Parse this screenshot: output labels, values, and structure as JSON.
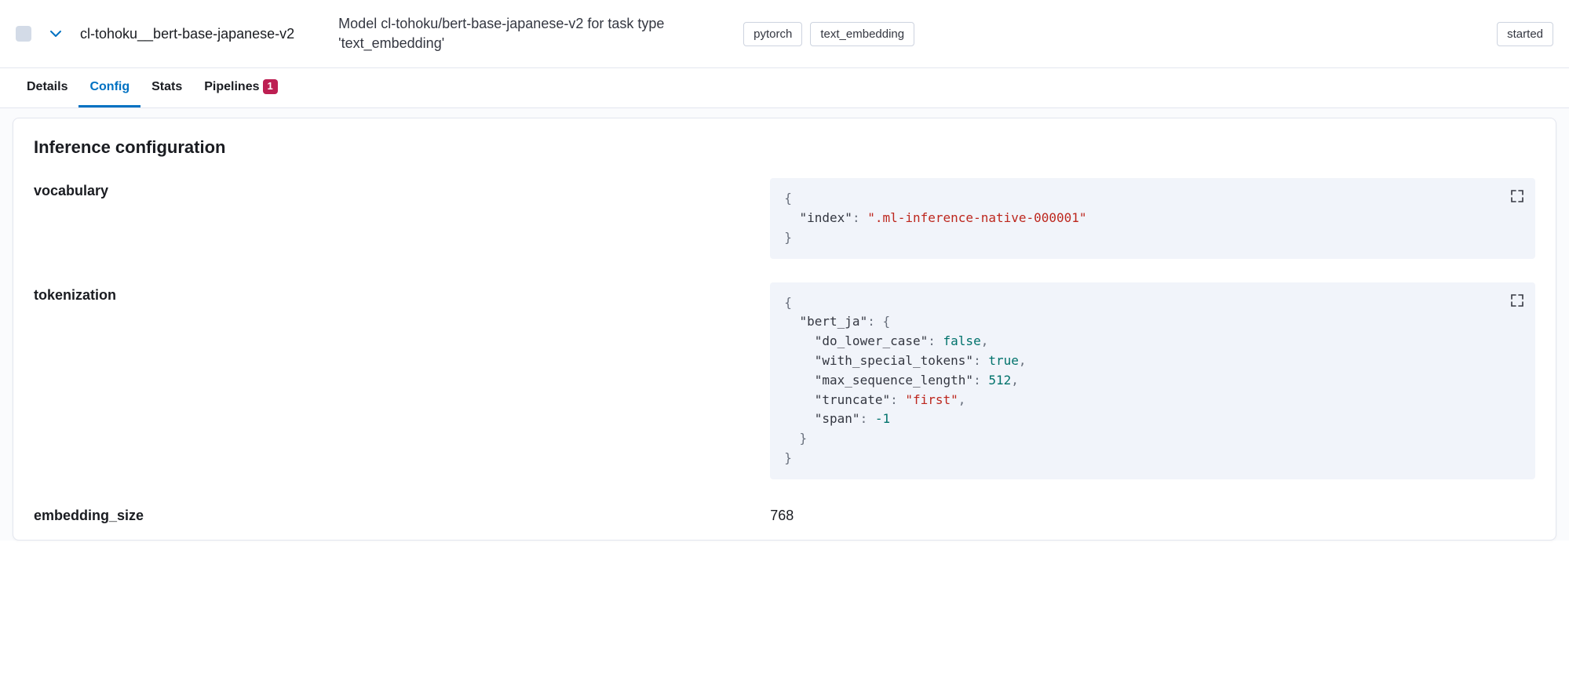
{
  "header": {
    "model_id": "cl-tohoku__bert-base-japanese-v2",
    "description": "Model cl-tohoku/bert-base-japanese-v2 for task type 'text_embedding'",
    "badges": [
      "pytorch",
      "text_embedding"
    ],
    "status_badge": "started"
  },
  "tabs": [
    {
      "label": "Details",
      "active": false,
      "badge": null
    },
    {
      "label": "Config",
      "active": true,
      "badge": null
    },
    {
      "label": "Stats",
      "active": false,
      "badge": null
    },
    {
      "label": "Pipelines",
      "active": false,
      "badge": "1"
    }
  ],
  "panel": {
    "title": "Inference configuration",
    "sections": {
      "vocabulary_label": "vocabulary",
      "tokenization_label": "tokenization",
      "embedding_label": "embedding_size",
      "embedding_value": "768"
    }
  },
  "config": {
    "vocabulary": {
      "index": ".ml-inference-native-000001"
    },
    "tokenization": {
      "bert_ja": {
        "do_lower_case": false,
        "with_special_tokens": true,
        "max_sequence_length": 512,
        "truncate": "first",
        "span": -1
      }
    }
  }
}
